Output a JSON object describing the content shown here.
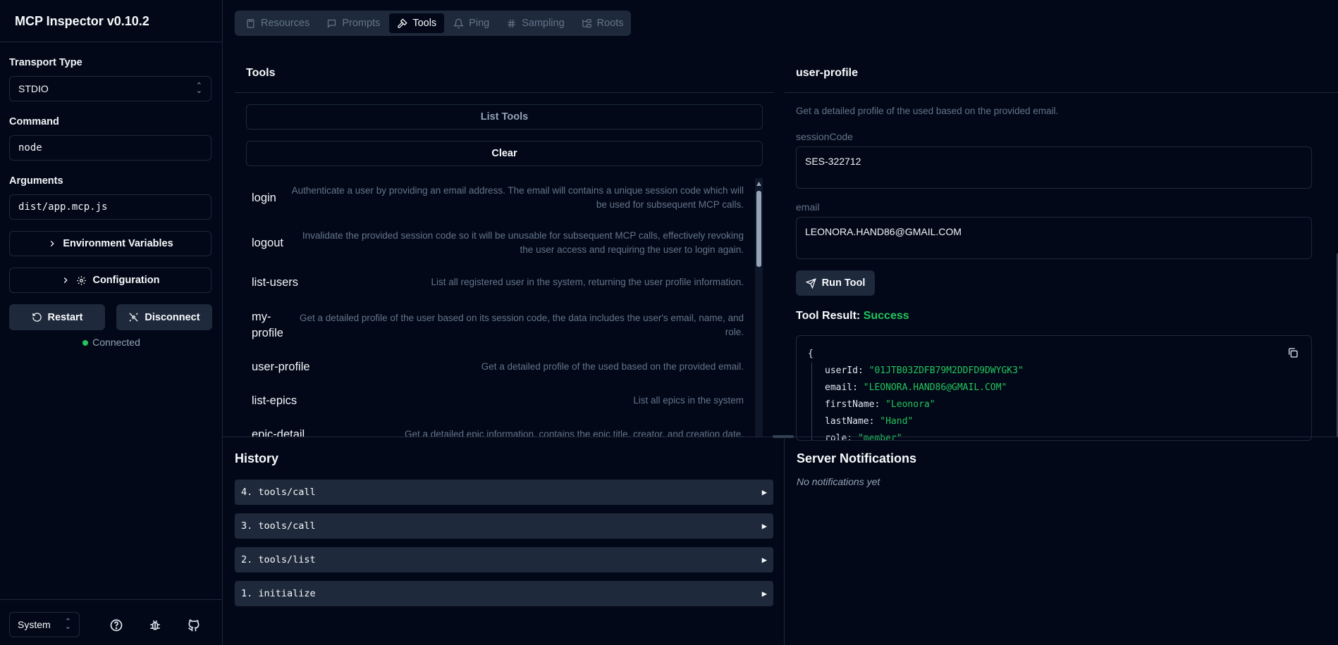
{
  "app": {
    "title": "MCP Inspector v0.10.2"
  },
  "sidebar": {
    "transport_label": "Transport Type",
    "transport_value": "STDIO",
    "command_label": "Command",
    "command_value": "node",
    "arguments_label": "Arguments",
    "arguments_value": "dist/app.mcp.js",
    "env_button": "Environment Variables",
    "config_button": "Configuration",
    "restart_button": "Restart",
    "disconnect_button": "Disconnect",
    "status": "Connected",
    "theme_value": "System"
  },
  "tabs": [
    {
      "label": "Resources",
      "icon": "file-icon"
    },
    {
      "label": "Prompts",
      "icon": "message-icon"
    },
    {
      "label": "Tools",
      "icon": "hammer-icon",
      "active": true
    },
    {
      "label": "Ping",
      "icon": "bell-icon"
    },
    {
      "label": "Sampling",
      "icon": "hash-icon"
    },
    {
      "label": "Roots",
      "icon": "folder-tree-icon"
    }
  ],
  "tools_panel": {
    "title": "Tools",
    "list_button": "List Tools",
    "clear_button": "Clear",
    "items": [
      {
        "name": "login",
        "desc": "Authenticate a user by providing an email address. The email will contains a unique session code which will be used for subsequent MCP calls."
      },
      {
        "name": "logout",
        "desc": "Invalidate the provided session code so it will be unusable for subsequent MCP calls, effectively revoking the user access and requiring the user to login again."
      },
      {
        "name": "list-users",
        "desc": "List all registered user in the system, returning the user profile information."
      },
      {
        "name": "my-profile",
        "desc": "Get a detailed profile of the user based on its session code, the data includes the user's email, name, and role."
      },
      {
        "name": "user-profile",
        "desc": "Get a detailed profile of the used based on the provided email."
      },
      {
        "name": "list-epics",
        "desc": "List all epics in the system"
      },
      {
        "name": "epic-detail",
        "desc": "Get a detailed epic information, contains the epic title, creator, and creation date."
      }
    ]
  },
  "detail": {
    "title": "user-profile",
    "desc": "Get a detailed profile of the used based on the provided email.",
    "session_label": "sessionCode",
    "session_value": "SES-322712",
    "email_label": "email",
    "email_value": "LEONORA.HAND86@GMAIL.COM",
    "run_button": "Run Tool",
    "result_label": "Tool Result:",
    "result_status": "Success",
    "result_open": "{",
    "result": [
      {
        "key": "userId:",
        "value": "\"01JTB03ZDFB79M2DDFD9DWYGK3\""
      },
      {
        "key": "email:",
        "value": "\"LEONORA.HAND86@GMAIL.COM\""
      },
      {
        "key": "firstName:",
        "value": "\"Leonora\""
      },
      {
        "key": "lastName:",
        "value": "\"Hand\""
      },
      {
        "key": "role:",
        "value": "\"member\""
      }
    ]
  },
  "history": {
    "title": "History",
    "items": [
      "4. tools/call",
      "3. tools/call",
      "2. tools/list",
      "1. initialize"
    ]
  },
  "notifications": {
    "title": "Server Notifications",
    "empty": "No notifications yet"
  }
}
